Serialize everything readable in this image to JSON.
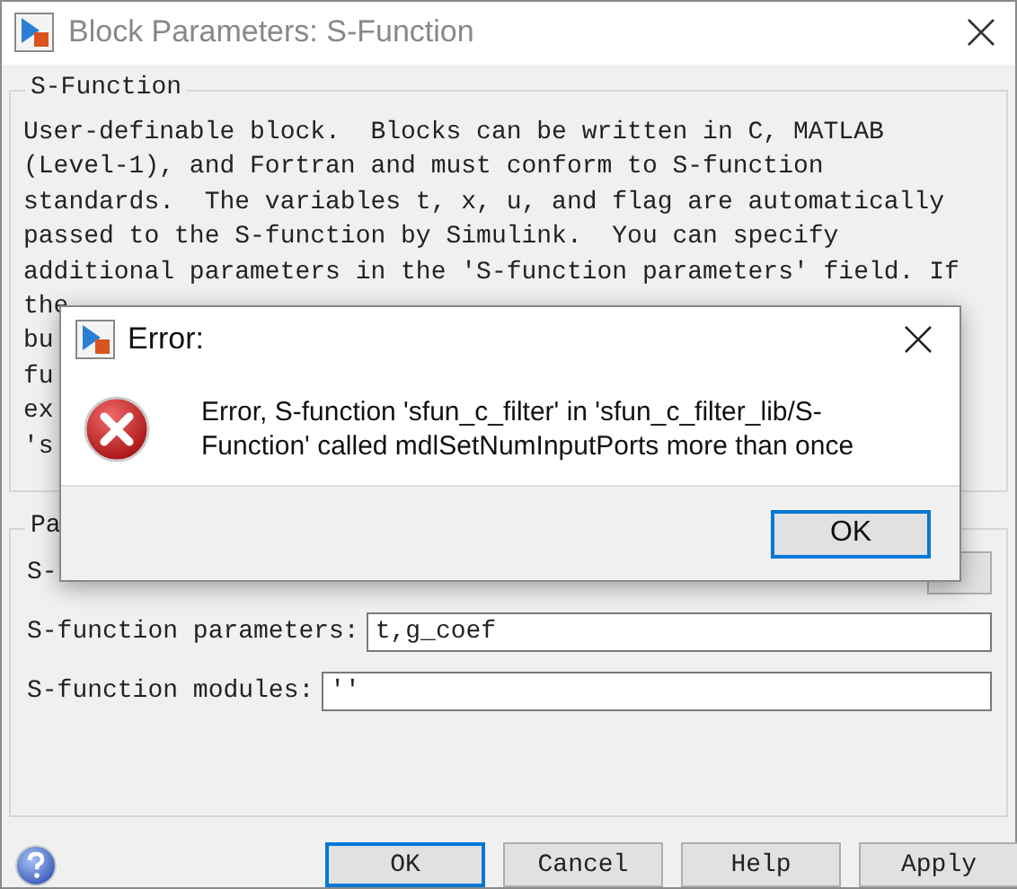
{
  "window": {
    "title": "Block Parameters: S-Function"
  },
  "description_group": {
    "title": "S-Function",
    "lines": [
      "User-definable block.  Blocks can be written in C, MATLAB",
      "(Level-1), and Fortran and must conform to S-function",
      "standards.  The variables t, x, u, and flag are automatically",
      "passed to the S-function by Simulink.  You can specify",
      "additional parameters in the 'S-function parameters' field. If"
    ],
    "fragments": [
      "the",
      "bu",
      "fu",
      "ex",
      "'s"
    ]
  },
  "parameters_group": {
    "title": "Pa",
    "fields": [
      {
        "label": "S-"
      },
      {
        "label": "S-function parameters:",
        "value": "t,g_coef"
      },
      {
        "label": "S-function modules:",
        "value": "''"
      }
    ]
  },
  "buttons": [
    {
      "label": "OK",
      "default": true
    },
    {
      "label": "Cancel",
      "default": false
    },
    {
      "label": "Help",
      "default": false
    },
    {
      "label": "Apply",
      "default": false
    }
  ],
  "error_dialog": {
    "title": "Error:",
    "message": "Error, S-function 'sfun_c_filter' in 'sfun_c_filter_lib/S-Function' called mdlSetNumInputPorts more than once",
    "button": {
      "label": "OK",
      "default": true
    }
  }
}
